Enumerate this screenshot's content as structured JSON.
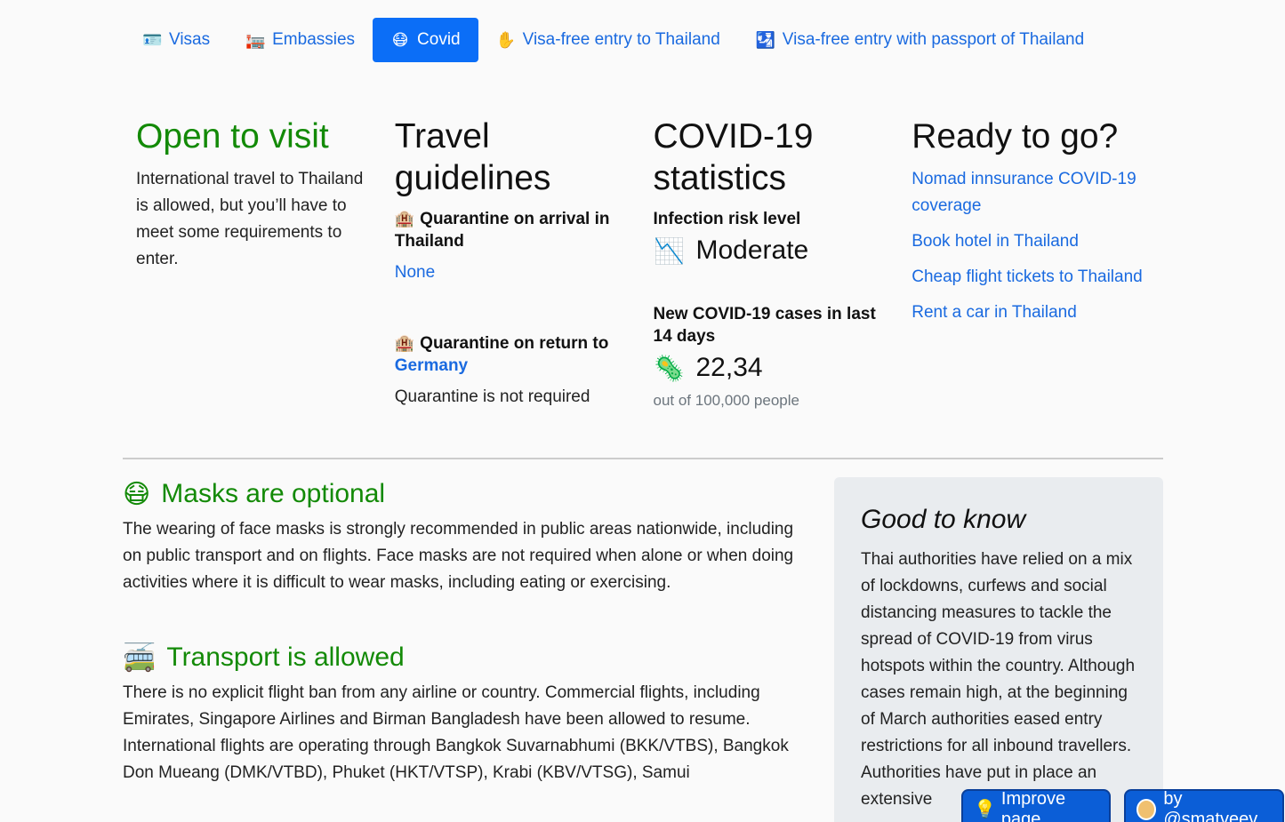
{
  "nav": {
    "items": [
      {
        "label": "Visas",
        "icon": "🪪"
      },
      {
        "label": "Embassies",
        "icon": "🏣"
      },
      {
        "label": "Covid",
        "icon": "😷"
      },
      {
        "label": "Visa-free entry to Thailand",
        "icon": "✋"
      },
      {
        "label": "Visa-free entry with passport of Thailand",
        "icon": "🛂"
      }
    ],
    "active": "Covid"
  },
  "summary": {
    "open": {
      "title": "Open to visit",
      "text": "International travel to Thailand is allowed, but you’ll have to meet some requirements to enter."
    },
    "guidelines": {
      "title": "Travel guidelines",
      "arrival_label": "Quarantine on arrival in Thailand",
      "arrival_value": "None",
      "return_label": "Quarantine on return to",
      "return_country": "Germany",
      "return_value": "Quarantine is not required",
      "icon": "🏨"
    },
    "stats": {
      "title": "COVID-19 statistics",
      "risk_label": "Infection risk level",
      "risk_value": "Moderate",
      "risk_icon": "📉",
      "cases_label": "New COVID-19 cases in last 14 days",
      "cases_value": "22,34",
      "cases_icon": "🦠",
      "cases_note": "out of 100,000 people"
    },
    "ready": {
      "title": "Ready to go?",
      "links": [
        "Nomad innsurance COVID-19 coverage",
        "Book hotel in Thailand",
        "Cheap flight tickets to Thailand",
        "Rent a car in Thailand"
      ]
    }
  },
  "sections": [
    {
      "icon": "😷",
      "title": "Masks are optional",
      "text": "The wearing of face masks is strongly recommended in public areas nationwide, including on public transport and on flights. Face masks are not required when alone or when doing activities where it is difficult to wear masks, including eating or exercising."
    },
    {
      "icon": "🚎",
      "title": "Transport is allowed",
      "text": "There is no explicit flight ban from any airline or country. Commercial flights, including Emirates, Singapore Airlines and Birman Bangladesh have been allowed to resume. International flights are operating through Bangkok Suvarnabhumi (BKK/VTBS), Bangkok Don Mueang (DMK/VTBD), Phuket (HKT/VTSP), Krabi (KBV/VTSG), Samui"
    }
  ],
  "aside": {
    "title": "Good to know",
    "text": "Thai authorities have relied on a mix of lockdowns, curfews and social distancing measures to tackle the spread of COVID-19 from virus hotspots within the country. Although cases remain high, at the beginning of March authorities eased entry restrictions for all inbound travellers. Authorities have put in place an extensive"
  },
  "buttons": {
    "improve": "Improve page",
    "improve_icon": "💡",
    "author": "by @smatveev"
  }
}
